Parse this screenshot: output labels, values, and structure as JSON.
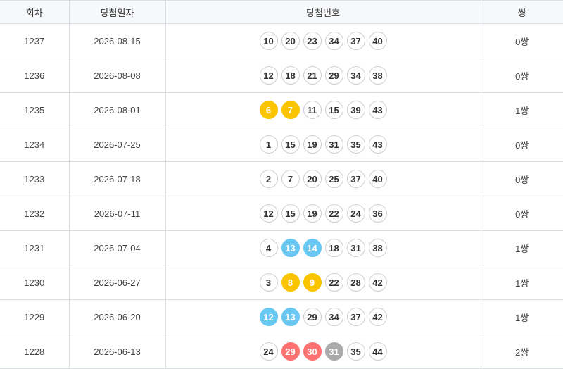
{
  "headers": {
    "round": "회차",
    "date": "당첨일자",
    "numbers": "당첨번호",
    "pairs": "쌍"
  },
  "rows": [
    {
      "round": "1237",
      "date": "2026-08-15",
      "pairs": "0쌍",
      "balls": [
        {
          "n": "10",
          "c": "white"
        },
        {
          "n": "20",
          "c": "white"
        },
        {
          "n": "23",
          "c": "white"
        },
        {
          "n": "34",
          "c": "white"
        },
        {
          "n": "37",
          "c": "white"
        },
        {
          "n": "40",
          "c": "white"
        }
      ]
    },
    {
      "round": "1236",
      "date": "2026-08-08",
      "pairs": "0쌍",
      "balls": [
        {
          "n": "12",
          "c": "white"
        },
        {
          "n": "18",
          "c": "white"
        },
        {
          "n": "21",
          "c": "white"
        },
        {
          "n": "29",
          "c": "white"
        },
        {
          "n": "34",
          "c": "white"
        },
        {
          "n": "38",
          "c": "white"
        }
      ]
    },
    {
      "round": "1235",
      "date": "2026-08-01",
      "pairs": "1쌍",
      "balls": [
        {
          "n": "6",
          "c": "yellow"
        },
        {
          "n": "7",
          "c": "yellow"
        },
        {
          "n": "11",
          "c": "white"
        },
        {
          "n": "15",
          "c": "white"
        },
        {
          "n": "39",
          "c": "white"
        },
        {
          "n": "43",
          "c": "white"
        }
      ]
    },
    {
      "round": "1234",
      "date": "2026-07-25",
      "pairs": "0쌍",
      "balls": [
        {
          "n": "1",
          "c": "white"
        },
        {
          "n": "15",
          "c": "white"
        },
        {
          "n": "19",
          "c": "white"
        },
        {
          "n": "31",
          "c": "white"
        },
        {
          "n": "35",
          "c": "white"
        },
        {
          "n": "43",
          "c": "white"
        }
      ]
    },
    {
      "round": "1233",
      "date": "2026-07-18",
      "pairs": "0쌍",
      "balls": [
        {
          "n": "2",
          "c": "white"
        },
        {
          "n": "7",
          "c": "white"
        },
        {
          "n": "20",
          "c": "white"
        },
        {
          "n": "25",
          "c": "white"
        },
        {
          "n": "37",
          "c": "white"
        },
        {
          "n": "40",
          "c": "white"
        }
      ]
    },
    {
      "round": "1232",
      "date": "2026-07-11",
      "pairs": "0쌍",
      "balls": [
        {
          "n": "12",
          "c": "white"
        },
        {
          "n": "15",
          "c": "white"
        },
        {
          "n": "19",
          "c": "white"
        },
        {
          "n": "22",
          "c": "white"
        },
        {
          "n": "24",
          "c": "white"
        },
        {
          "n": "36",
          "c": "white"
        }
      ]
    },
    {
      "round": "1231",
      "date": "2026-07-04",
      "pairs": "1쌍",
      "balls": [
        {
          "n": "4",
          "c": "white"
        },
        {
          "n": "13",
          "c": "blue"
        },
        {
          "n": "14",
          "c": "blue"
        },
        {
          "n": "18",
          "c": "white"
        },
        {
          "n": "31",
          "c": "white"
        },
        {
          "n": "38",
          "c": "white"
        }
      ]
    },
    {
      "round": "1230",
      "date": "2026-06-27",
      "pairs": "1쌍",
      "balls": [
        {
          "n": "3",
          "c": "white"
        },
        {
          "n": "8",
          "c": "yellow"
        },
        {
          "n": "9",
          "c": "yellow"
        },
        {
          "n": "22",
          "c": "white"
        },
        {
          "n": "28",
          "c": "white"
        },
        {
          "n": "42",
          "c": "white"
        }
      ]
    },
    {
      "round": "1229",
      "date": "2026-06-20",
      "pairs": "1쌍",
      "balls": [
        {
          "n": "12",
          "c": "blue"
        },
        {
          "n": "13",
          "c": "blue"
        },
        {
          "n": "29",
          "c": "white"
        },
        {
          "n": "34",
          "c": "white"
        },
        {
          "n": "37",
          "c": "white"
        },
        {
          "n": "42",
          "c": "white"
        }
      ]
    },
    {
      "round": "1228",
      "date": "2026-06-13",
      "pairs": "2쌍",
      "balls": [
        {
          "n": "24",
          "c": "white"
        },
        {
          "n": "29",
          "c": "red"
        },
        {
          "n": "30",
          "c": "red"
        },
        {
          "n": "31",
          "c": "gray"
        },
        {
          "n": "35",
          "c": "white"
        },
        {
          "n": "44",
          "c": "white"
        }
      ]
    }
  ]
}
